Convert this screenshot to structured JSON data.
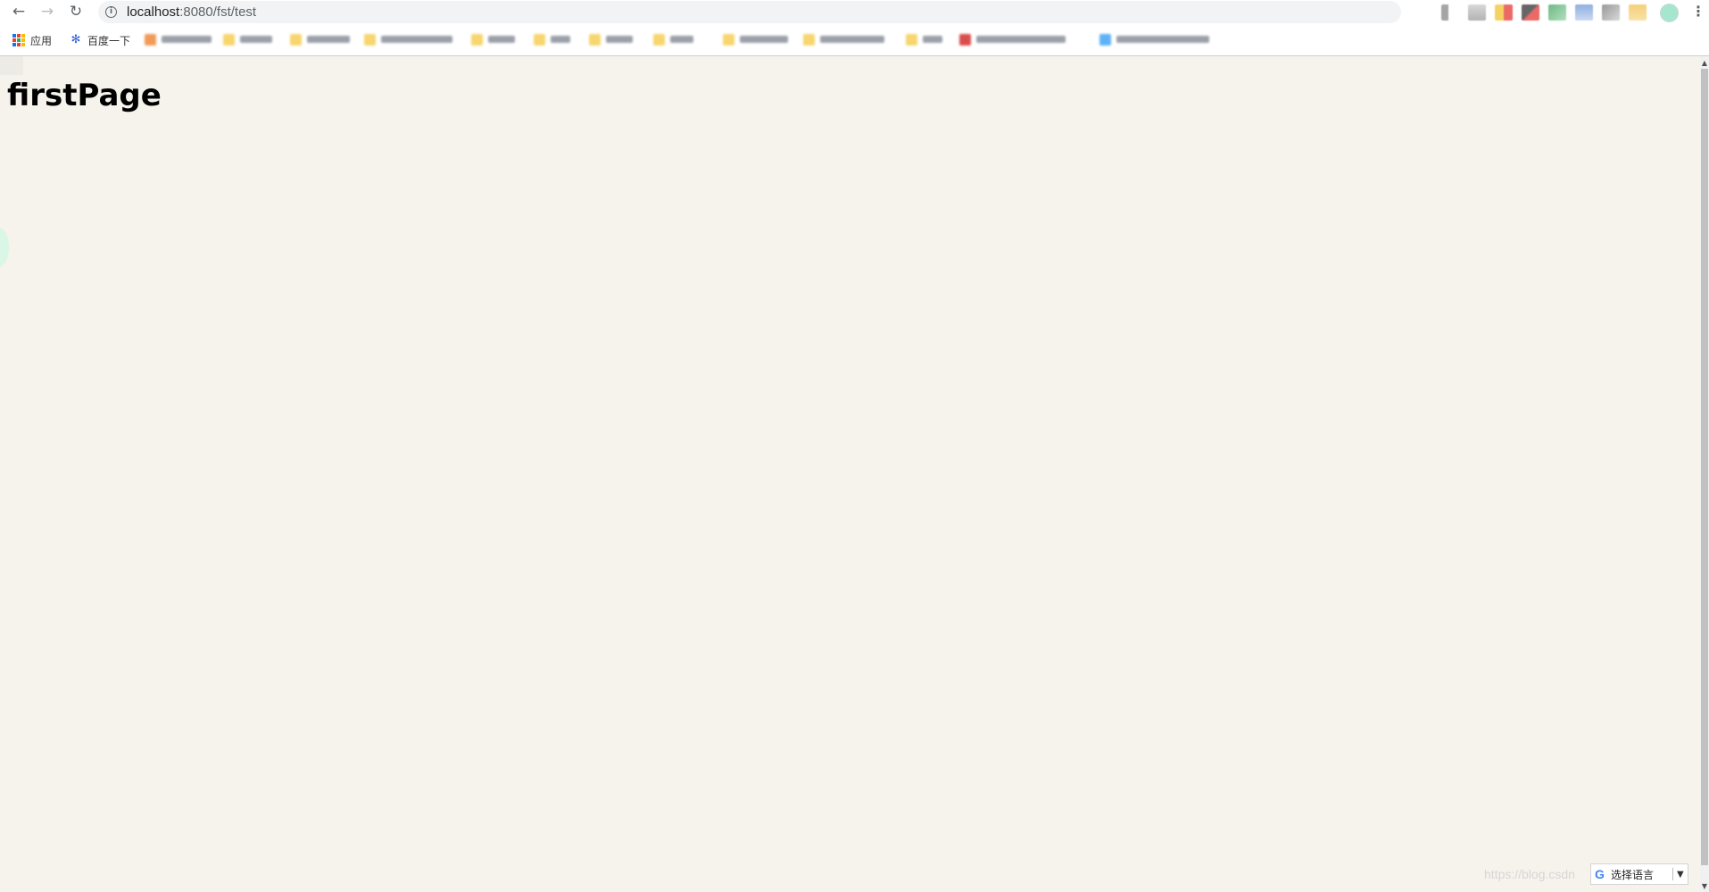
{
  "browser": {
    "url_host": "localhost",
    "url_rest": ":8080/fst/test",
    "back_glyph": "←",
    "forward_glyph": "→",
    "reload_glyph": "↻",
    "info_glyph": "i",
    "menu_glyph": "⋮"
  },
  "bookmarks": {
    "apps_label": "应用",
    "baidu_label": "百度一下",
    "baidu_glyph": "✻"
  },
  "page": {
    "title": "firstPage"
  },
  "translate_widget": {
    "g_glyph": "G",
    "label": "选择语言",
    "arrow": "▼"
  },
  "watermark": {
    "text": "https://blog.csdn"
  },
  "scrollbar": {
    "up": "▲",
    "down": "▼"
  },
  "colors": {
    "page_background": "#f6f3ec",
    "apps_blue": "#1a73e8",
    "baidu_blue": "#2e5fd6"
  }
}
